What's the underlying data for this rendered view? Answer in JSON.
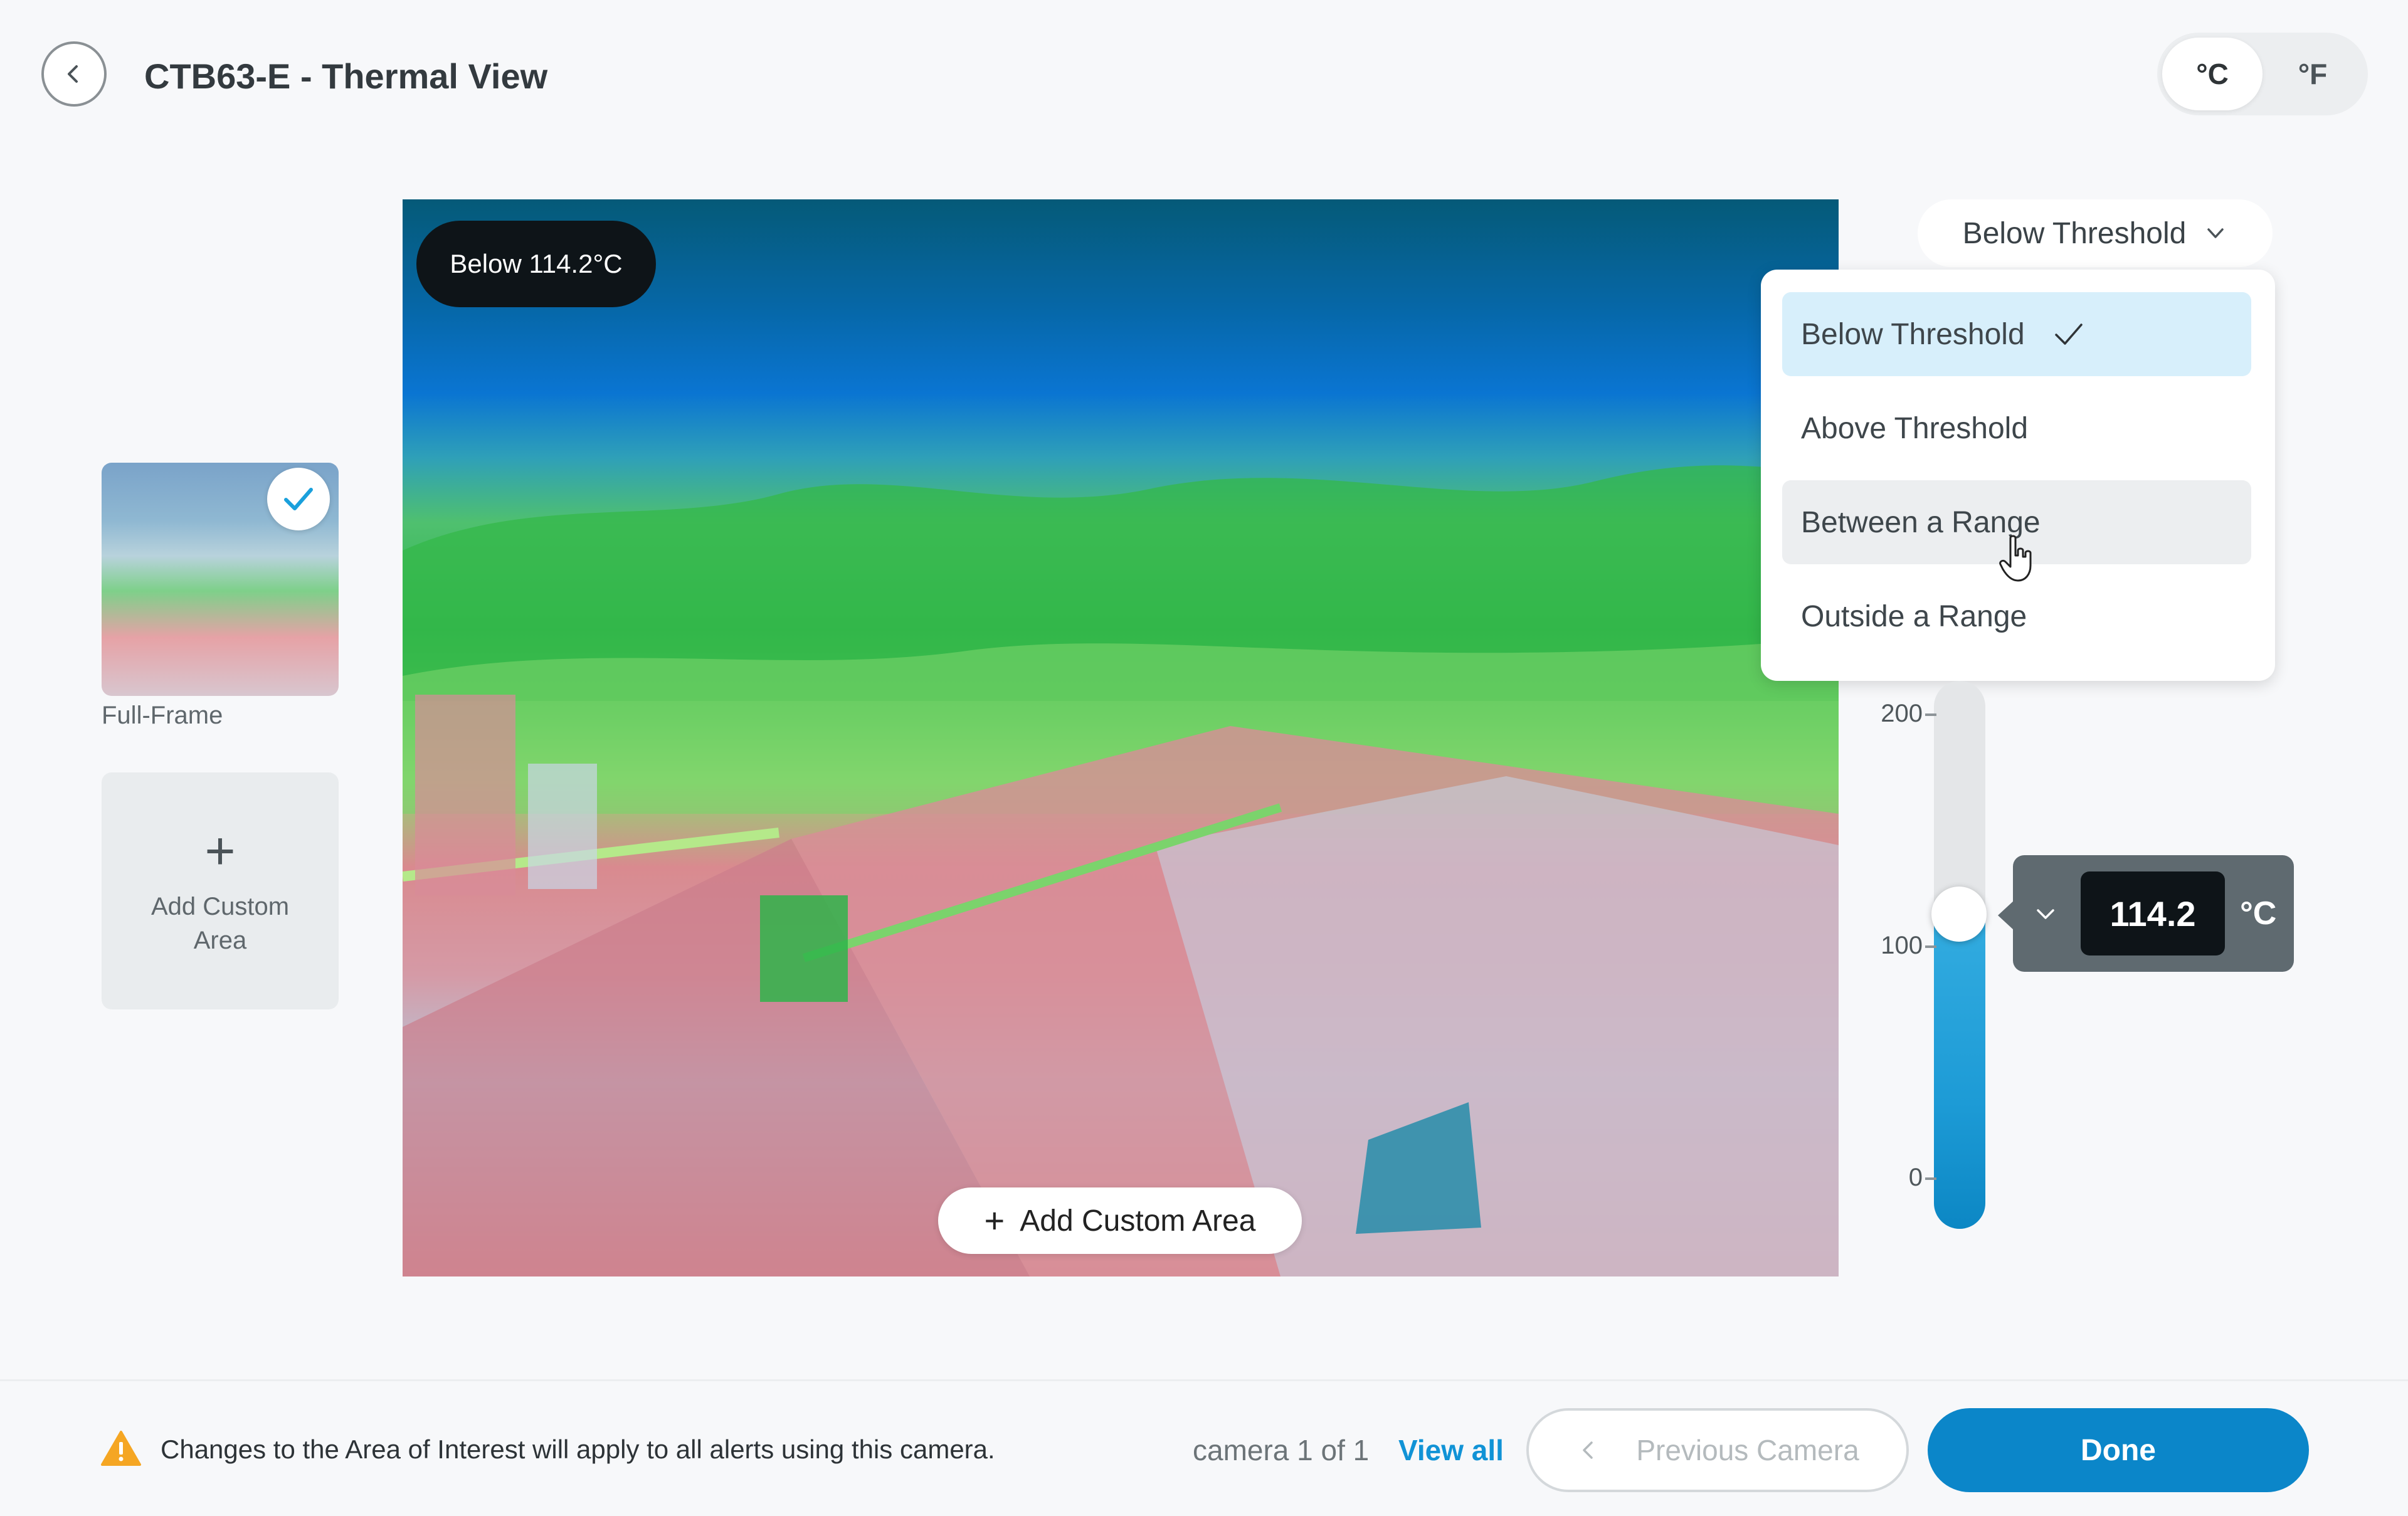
{
  "header": {
    "title": "CTB63-E - Thermal View",
    "units": [
      {
        "label": "°C",
        "active": true
      },
      {
        "label": "°F",
        "active": false
      }
    ]
  },
  "areas": {
    "full_frame_label": "Full-Frame",
    "add_custom_label": "Add Custom Area"
  },
  "thermal": {
    "badge": "Below 114.2°C",
    "add_custom_label": "Add Custom Area"
  },
  "threshold": {
    "selected": "Below Threshold",
    "options": [
      "Below Threshold",
      "Above Threshold",
      "Between a Range",
      "Outside a Range"
    ],
    "scale_labels": [
      "200",
      "100",
      "0"
    ],
    "value": "114.2",
    "unit": "°C"
  },
  "footer": {
    "warning": "Changes to the Area of Interest will apply to all alerts using this camera.",
    "camera_count": "camera 1 of 1",
    "view_all": "View all",
    "previous_camera": "Previous Camera",
    "done": "Done"
  },
  "colors": {
    "accent": "#0b86c9",
    "link": "#1193d6",
    "warning": "#f5a623",
    "menu_selected": "#d7effb"
  }
}
